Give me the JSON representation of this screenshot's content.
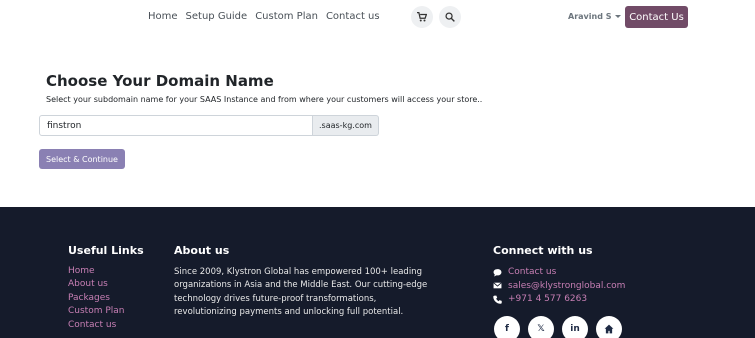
{
  "header": {
    "nav": [
      "Home",
      "Setup Guide",
      "Custom Plan",
      "Contact us"
    ],
    "cart_icon": "cart-icon",
    "search_icon": "search-icon",
    "user_name": "Aravind S",
    "contact_button": "Contact Us"
  },
  "main": {
    "title": "Choose Your Domain Name",
    "subtitle": "Select your subdomain name for your SAAS Instance and from where your customers will access your store..",
    "domain_value": "finstron",
    "domain_suffix": ".saas-kg.com",
    "submit_label": "Select & Continue"
  },
  "footer": {
    "useful_links": {
      "heading": "Useful Links",
      "items": [
        "Home",
        "About us",
        "Packages",
        "Custom Plan",
        "Contact us"
      ]
    },
    "about": {
      "heading": "About us",
      "text": "Since 2009, Klystron Global has empowered 100+ leading organizations in Asia and the Middle East. Our cutting-edge technology drives future-proof transformations, revolutionizing payments and unlocking full potential."
    },
    "connect": {
      "heading": "Connect with us",
      "contact_label": "Contact us",
      "email": "sales@klystronglobal.com",
      "phone": "+971 4 577 6263"
    },
    "social": [
      "facebook-icon",
      "x-icon",
      "linkedin-icon",
      "home-icon"
    ]
  },
  "colors": {
    "primary": "#714b67",
    "select_button": "#8a80b3",
    "footer_bg": "#151b2b",
    "link": "#c77fb4"
  }
}
